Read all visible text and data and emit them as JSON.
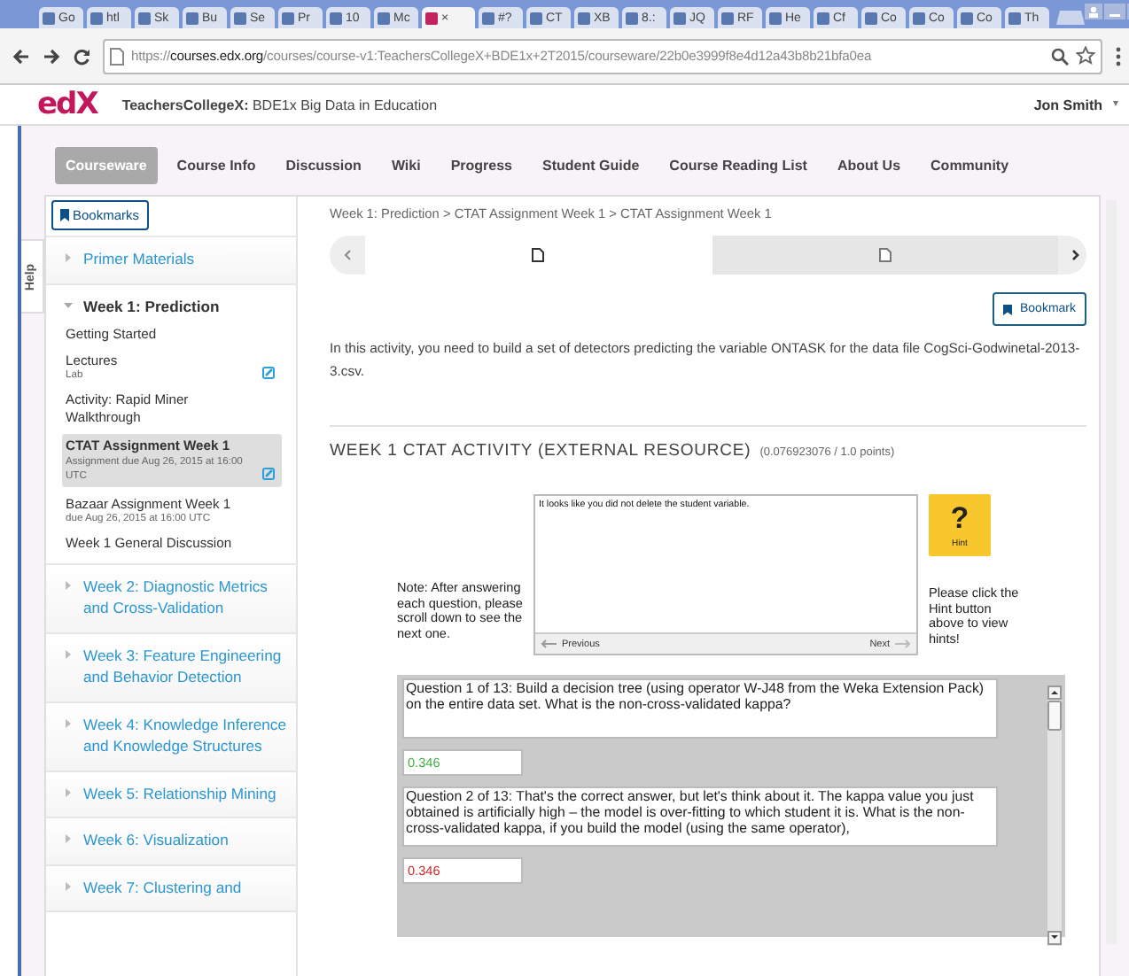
{
  "browser": {
    "tabs": [
      {
        "label": "Go",
        "selected": false
      },
      {
        "label": "htl",
        "selected": false
      },
      {
        "label": "Sk",
        "selected": false
      },
      {
        "label": "Bu",
        "selected": false
      },
      {
        "label": "Se",
        "selected": false
      },
      {
        "label": "Pr",
        "selected": false
      },
      {
        "label": "10",
        "selected": false
      },
      {
        "label": "Mc",
        "selected": false
      },
      {
        "label": "×",
        "selected": true
      },
      {
        "label": "#?",
        "selected": false
      },
      {
        "label": "CT",
        "selected": false
      },
      {
        "label": "XB",
        "selected": false
      },
      {
        "label": "8.:",
        "selected": false
      },
      {
        "label": "JQ",
        "selected": false
      },
      {
        "label": "RF",
        "selected": false
      },
      {
        "label": "He",
        "selected": false
      },
      {
        "label": "Cf",
        "selected": false
      },
      {
        "label": "Co",
        "selected": false
      },
      {
        "label": "Co",
        "selected": false
      },
      {
        "label": "Co",
        "selected": false
      },
      {
        "label": "Th",
        "selected": false
      }
    ],
    "url_scheme": "https://",
    "url_host": "courses.edx.org",
    "url_path": "/courses/course-v1:TeachersCollegeX+BDE1x+2T2015/courseware/22b0e3999f8e4d12a43b8b21bfa0ea"
  },
  "header": {
    "logo": "edX",
    "course": "**TeachersCollegeX:** BDE1x Big Data in Education",
    "user": "Jon Smith"
  },
  "nav": [
    {
      "label": "Courseware",
      "selected": true
    },
    {
      "label": "Course Info",
      "selected": false
    },
    {
      "label": "Discussion",
      "selected": false
    },
    {
      "label": "Wiki",
      "selected": false
    },
    {
      "label": "Progress",
      "selected": false
    },
    {
      "label": "Student Guide",
      "selected": false
    },
    {
      "label": "Course Reading List",
      "selected": false
    },
    {
      "label": "About Us",
      "selected": false
    },
    {
      "label": "Community",
      "selected": false
    }
  ],
  "help_tab": "Help",
  "sidebar": {
    "bookmarks": "Bookmarks",
    "sections": [
      {
        "title": "Primer Materials",
        "expanded": false
      },
      {
        "title": "Week 1: Prediction",
        "expanded": true,
        "children": [
          {
            "title": "Getting Started",
            "selected": false,
            "graded": false
          },
          {
            "title": "Lectures",
            "subtitle": "Lab",
            "selected": false,
            "graded": true
          },
          {
            "title": "Activity: Rapid Miner Walkthrough",
            "selected": false,
            "graded": false
          },
          {
            "title": "CTAT Assignment Week 1",
            "subtitle": "Assignment due Aug 26, 2015 at 16:00 UTC",
            "selected": true,
            "graded": true
          },
          {
            "title": "Bazaar Assignment Week 1",
            "subtitle": "due Aug 26, 2015 at 16:00 UTC",
            "selected": false,
            "graded": false
          },
          {
            "title": "Week 1 General Discussion",
            "selected": false,
            "graded": false
          }
        ]
      },
      {
        "title": "Week 2: Diagnostic Metrics and Cross-Validation",
        "expanded": false
      },
      {
        "title": "Week 3: Feature Engineering and Behavior Detection",
        "expanded": false
      },
      {
        "title": "Week 4: Knowledge Inference and Knowledge Structures",
        "expanded": false
      },
      {
        "title": "Week 5: Relationship Mining",
        "expanded": false
      },
      {
        "title": "Week 6: Visualization",
        "expanded": false
      },
      {
        "title": "Week 7: Clustering and",
        "expanded": false
      }
    ]
  },
  "content": {
    "breadcrumb": "Week 1: Prediction > CTAT Assignment Week 1 > CTAT Assignment Week 1",
    "units": [
      {
        "selected": true
      },
      {
        "selected": false
      }
    ],
    "bookmark": "Bookmark",
    "intro": "In this activity, you need to build a set of detectors predicting the variable ONTASK for the data file CogSci-Godwinetal-2013-3.csv.",
    "heading": "WEEK 1 CTAT ACTIVITY (EXTERNAL RESOURCE)",
    "points": "(0.076923076 / 1.0 points)",
    "ctat": {
      "note": "Note: After answering each question, please scroll down to see the next one.",
      "feedback": "It looks like you did not delete the student variable.",
      "previous": "Previous",
      "next": "Next",
      "hint_symbol": "?",
      "hint": "Hint",
      "hint_note": "Please click the Hint button above to view hints!",
      "questions": [
        {
          "prompt": "Question 1 of 13: Build a decision tree (using operator W-J48 from the Weka Extension Pack) on the entire data set. What is the non-cross-validated kappa?",
          "answer": "0.346",
          "correct": true
        },
        {
          "prompt": "Question 2 of 13: That's the correct answer, but let's think about it. The kappa value you just obtained is artificially high – the model is over-fitting to which student it is. What is the non-cross-validated kappa, if you build the model (using the same operator),",
          "answer": "0.346",
          "correct": false
        }
      ]
    }
  }
}
